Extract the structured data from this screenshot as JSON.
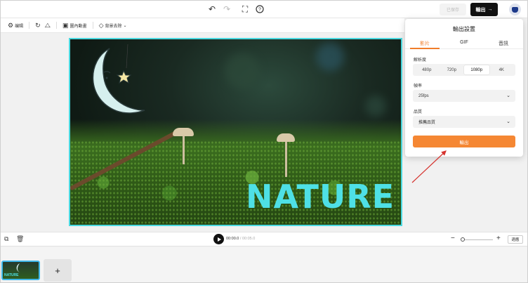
{
  "topbar": {
    "undo_icon": "undo-icon",
    "redo_icon": "redo-icon",
    "fit_icon": "fullscreen-icon",
    "help_icon": "help-icon",
    "saved_label": "已保存",
    "export_label": "輸出",
    "export_arrow": "→"
  },
  "toolbar": {
    "items": [
      {
        "icon": "⚙",
        "label": "编辑"
      },
      {
        "icon": "↻",
        "label": ""
      },
      {
        "icon": "⧍",
        "label": ""
      },
      {
        "icon": "▣",
        "label": "圖內動畫"
      },
      {
        "icon": "◇",
        "label": "背景去除"
      }
    ]
  },
  "canvas": {
    "overlay_text": "NATURE"
  },
  "controls": {
    "current_time": "00:00.0",
    "separator": " / ",
    "total_time": "00:05.0",
    "fit_label": "適應",
    "zoom_level": 0.0
  },
  "strip": {
    "thumb_text": "NATURE",
    "add_label": "+"
  },
  "export_panel": {
    "title": "輸出設置",
    "tabs": [
      "影片",
      "GIF",
      "音訊"
    ],
    "active_tab": 0,
    "resolution_label": "解析度",
    "resolutions": [
      "480p",
      "720p",
      "1080p",
      "4K"
    ],
    "active_resolution": 2,
    "framerate_label": "幀率",
    "framerate_value": "25fps",
    "quality_label": "品質",
    "quality_value": "推薦品質",
    "export_button": "輸出"
  },
  "colors": {
    "accent": "#f58733",
    "canvas_border": "#4ad9e0",
    "nature_text": "#4ee0e6",
    "arrow": "#d6342f"
  }
}
